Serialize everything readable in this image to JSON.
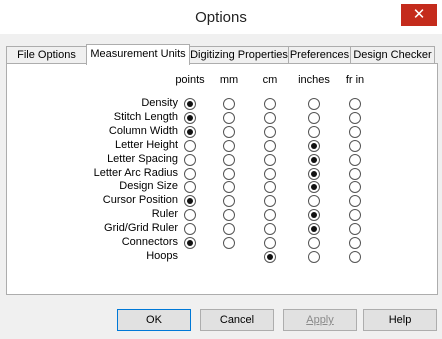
{
  "window": {
    "title": "Options",
    "close_glyph": "✕"
  },
  "tabs": [
    "File Options",
    "Measurement Units",
    "Digitizing Properties",
    "Preferences",
    "Design Checker"
  ],
  "active_tab": "Measurement Units",
  "columns": [
    "points",
    "mm",
    "cm",
    "inches",
    "fr in"
  ],
  "rows": [
    {
      "label": "Density",
      "selected": "points",
      "options": 5
    },
    {
      "label": "Stitch Length",
      "selected": "points",
      "options": 5
    },
    {
      "label": "Column Width",
      "selected": "points",
      "options": 5
    },
    {
      "label": "Letter Height",
      "selected": "inches",
      "options": 5
    },
    {
      "label": "Letter Spacing",
      "selected": "inches",
      "options": 5
    },
    {
      "label": "Letter Arc Radius",
      "selected": "inches",
      "options": 5
    },
    {
      "label": "Design Size",
      "selected": "inches",
      "options": 5
    },
    {
      "label": "Cursor Position",
      "selected": "points",
      "options": 5
    },
    {
      "label": "Ruler",
      "selected": "inches",
      "options": 5
    },
    {
      "label": "Grid/Grid Ruler",
      "selected": "inches",
      "options": 5
    },
    {
      "label": "Connectors",
      "selected": "points",
      "options": 5
    },
    {
      "label": "Hoops",
      "selected": "cm",
      "options": 3
    }
  ],
  "buttons": {
    "ok": "OK",
    "cancel": "Cancel",
    "apply": "Apply",
    "help": "Help"
  },
  "colors": {
    "close_button": "#c42b1c",
    "default_button_border": "#0078d7"
  }
}
